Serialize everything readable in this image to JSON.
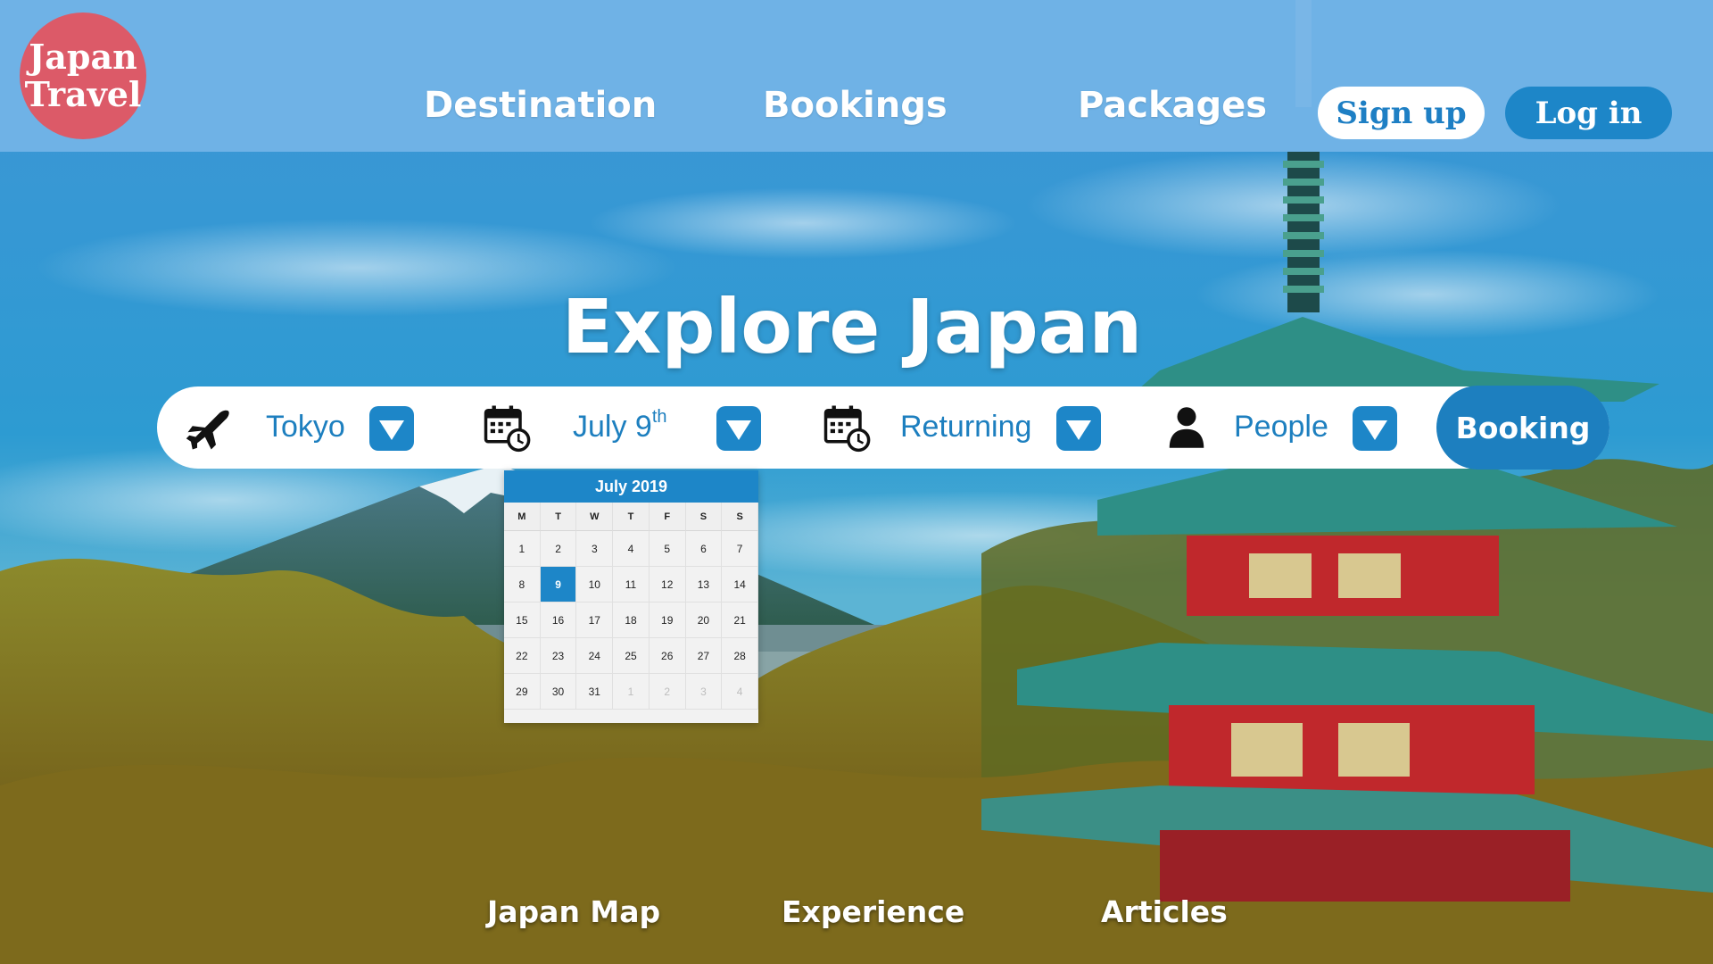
{
  "brand": {
    "line1": "Japan",
    "line2": "Travel",
    "color": "#dc5a68"
  },
  "nav": {
    "links": [
      "Destination",
      "Bookings",
      "Packages"
    ],
    "signup_label": "Sign up",
    "login_label": "Log in"
  },
  "hero": {
    "title": "Explore Japan"
  },
  "search": {
    "from": {
      "icon": "airplane-icon",
      "value": "Tokyo"
    },
    "depart": {
      "icon": "calendar-clock-icon",
      "value": "July 9",
      "suffix": "th"
    },
    "return": {
      "icon": "calendar-clock-icon",
      "value": "Returning"
    },
    "people": {
      "icon": "person-icon",
      "value": "People"
    },
    "booking_label": "Booking"
  },
  "calendar": {
    "title": "July 2019",
    "weekdays": [
      "M",
      "T",
      "W",
      "T",
      "F",
      "S",
      "S"
    ],
    "selected_day": 9,
    "weeks": [
      [
        "1",
        "2",
        "3",
        "4",
        "5",
        "6",
        "7"
      ],
      [
        "8",
        "9",
        "10",
        "11",
        "12",
        "13",
        "14"
      ],
      [
        "15",
        "16",
        "17",
        "18",
        "19",
        "20",
        "21"
      ],
      [
        "22",
        "23",
        "24",
        "25",
        "26",
        "27",
        "28"
      ],
      [
        "29",
        "30",
        "31",
        "1",
        "2",
        "3",
        "4"
      ]
    ],
    "trailing_next_month_count": 4
  },
  "footer_links": [
    "Japan Map",
    "Experience",
    "Articles"
  ],
  "colors": {
    "accent": "#1d86c8",
    "accent_dark": "#1d7fbf",
    "header_bg": "#76b6e8"
  }
}
